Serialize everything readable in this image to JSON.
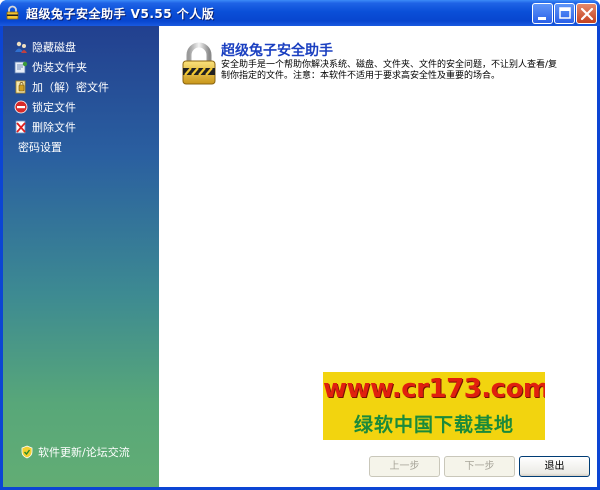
{
  "window": {
    "title": "超级兔子安全助手 V5.55 个人版",
    "colors": {
      "titlebar": "#0a4fd8",
      "sidebar_top": "#22408f",
      "sidebar_bottom": "#62ad74",
      "heading": "#1a3fc0"
    }
  },
  "sidebar": {
    "items": [
      {
        "label": "隐藏磁盘",
        "icon": "hidden-disk-icon"
      },
      {
        "label": "伪装文件夹",
        "icon": "folder-disguise-icon"
      },
      {
        "label": "加（解）密文件",
        "icon": "encrypt-file-icon"
      },
      {
        "label": "锁定文件",
        "icon": "lock-file-icon"
      },
      {
        "label": "删除文件",
        "icon": "delete-file-icon"
      },
      {
        "label": "密码设置",
        "icon": ""
      }
    ],
    "footer_label": "软件更新/论坛交流",
    "footer_icon": "shield-icon"
  },
  "main": {
    "heading": "超级兔子安全助手",
    "description": "安全助手是一个帮助你解决系统、磁盘、文件夹、文件的安全问题，不让别人查看/复制你指定的文件。注意：本软件不适用于要求高安全性及重要的场合。",
    "icon": "padlock-icon"
  },
  "watermark": {
    "url": "www.cr173.com",
    "subtitle": "绿软中国下载基地"
  },
  "buttons": {
    "prev": "上一步",
    "next": "下一步",
    "exit": "退出"
  }
}
